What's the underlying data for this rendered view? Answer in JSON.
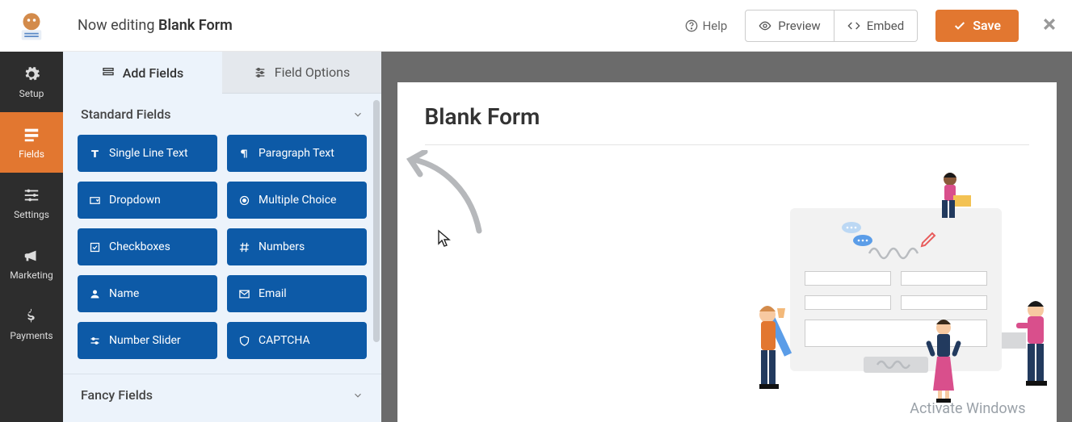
{
  "topbar": {
    "editing_prefix": "Now editing ",
    "form_name": "Blank Form",
    "help": "Help",
    "preview": "Preview",
    "embed": "Embed",
    "save": "Save"
  },
  "rail": {
    "items": [
      {
        "id": "setup",
        "label": "Setup"
      },
      {
        "id": "fields",
        "label": "Fields"
      },
      {
        "id": "settings",
        "label": "Settings"
      },
      {
        "id": "marketing",
        "label": "Marketing"
      },
      {
        "id": "payments",
        "label": "Payments"
      }
    ],
    "active": "fields"
  },
  "panel": {
    "tabs": {
      "add": "Add Fields",
      "options": "Field Options"
    },
    "sections": [
      {
        "id": "standard",
        "title": "Standard Fields",
        "expanded": true
      },
      {
        "id": "fancy",
        "title": "Fancy Fields",
        "expanded": false
      }
    ],
    "standard_fields": [
      {
        "id": "text",
        "label": "Single Line Text"
      },
      {
        "id": "paragraph",
        "label": "Paragraph Text"
      },
      {
        "id": "dropdown",
        "label": "Dropdown"
      },
      {
        "id": "multiple",
        "label": "Multiple Choice"
      },
      {
        "id": "check",
        "label": "Checkboxes"
      },
      {
        "id": "numbers",
        "label": "Numbers"
      },
      {
        "id": "name",
        "label": "Name"
      },
      {
        "id": "email",
        "label": "Email"
      },
      {
        "id": "slider",
        "label": "Number Slider"
      },
      {
        "id": "captcha",
        "label": "CAPTCHA"
      }
    ]
  },
  "canvas": {
    "title": "Blank Form"
  },
  "watermark": "Activate Windows"
}
